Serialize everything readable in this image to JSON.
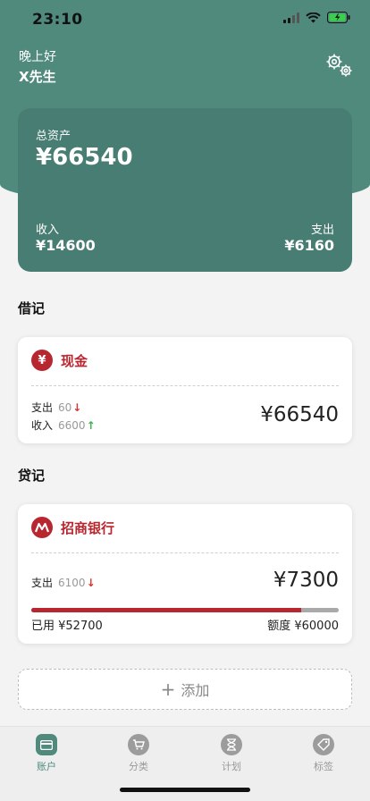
{
  "status": {
    "time": "23:10"
  },
  "header": {
    "greeting": "晚上好",
    "user": "X先生"
  },
  "summary": {
    "total_label": "总资产",
    "total_value": "¥66540",
    "income_label": "收入",
    "income_value": "¥14600",
    "expense_label": "支出",
    "expense_value": "¥6160"
  },
  "sections": {
    "debit": "借记",
    "credit": "贷记"
  },
  "cash": {
    "icon_text": "¥",
    "name": "现金",
    "expense_label": "支出",
    "expense_value": "60",
    "income_label": "收入",
    "income_value": "6600",
    "balance": "¥66540"
  },
  "bank": {
    "name": "招商银行",
    "expense_label": "支出",
    "expense_value": "6100",
    "balance": "¥7300",
    "used_label": "已用 ¥52700",
    "limit_label": "额度 ¥60000",
    "used_fraction": 0.878
  },
  "add": {
    "label": "添加"
  },
  "tabs": [
    {
      "label": "账户",
      "icon": "card-icon"
    },
    {
      "label": "分类",
      "icon": "cart-icon"
    },
    {
      "label": "计划",
      "icon": "hourglass-icon"
    },
    {
      "label": "标签",
      "icon": "tag-icon"
    }
  ],
  "colors": {
    "primary": "#4f8a7d",
    "card": "#477d72",
    "accent": "#b8262f",
    "up": "#3bb24a",
    "down": "#d9342b"
  }
}
